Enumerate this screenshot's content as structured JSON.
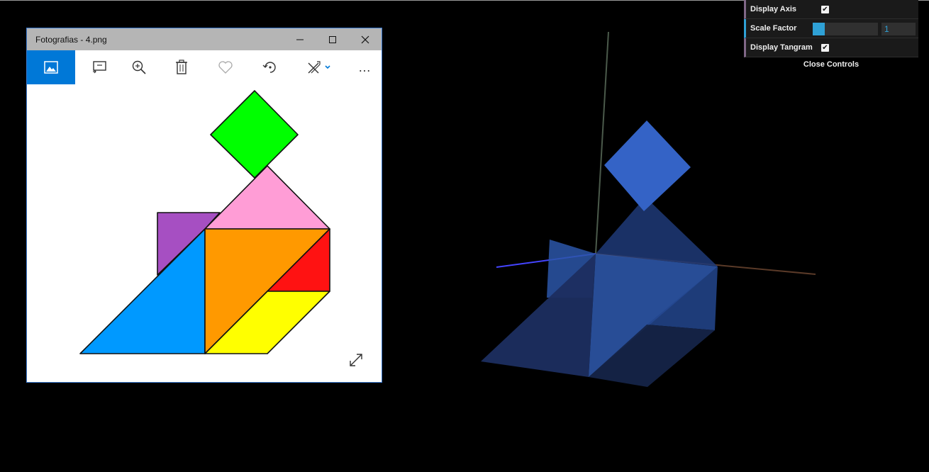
{
  "window": {
    "title": "Fotografias - 4.png",
    "controls": [
      "minimize",
      "maximize",
      "close"
    ]
  },
  "toolbar": {
    "items": [
      {
        "name": "image-icon",
        "active": true
      },
      {
        "name": "slideshow-icon"
      },
      {
        "name": "zoom-in-icon"
      },
      {
        "name": "delete-icon"
      },
      {
        "name": "favorite-heart-icon"
      },
      {
        "name": "rotate-icon"
      },
      {
        "name": "edit-create-icon"
      },
      {
        "name": "more-options-icon",
        "glyph": "…"
      }
    ]
  },
  "tangram": {
    "colors": {
      "green": "#00ff00",
      "pink": "#ff9dd6",
      "purple": "#a64fc2",
      "blue": "#0099ff",
      "orange": "#ff9900",
      "red": "#ff1212",
      "yellow": "#ffff00"
    }
  },
  "gui": {
    "display_axis": {
      "label": "Display Axis",
      "checked": true
    },
    "scale_factor": {
      "label": "Scale Factor",
      "value": "1",
      "fill_fraction": 0.18
    },
    "display_tangram": {
      "label": "Display Tangram",
      "checked": true
    },
    "close_label": "Close Controls",
    "accent_color": "#2fa1d6"
  },
  "scene": {
    "shape_color": "#3366cc",
    "axis_colors": {
      "x": "#4a2a1a",
      "y": "#3a4a3a",
      "z": "#3333ff"
    }
  }
}
